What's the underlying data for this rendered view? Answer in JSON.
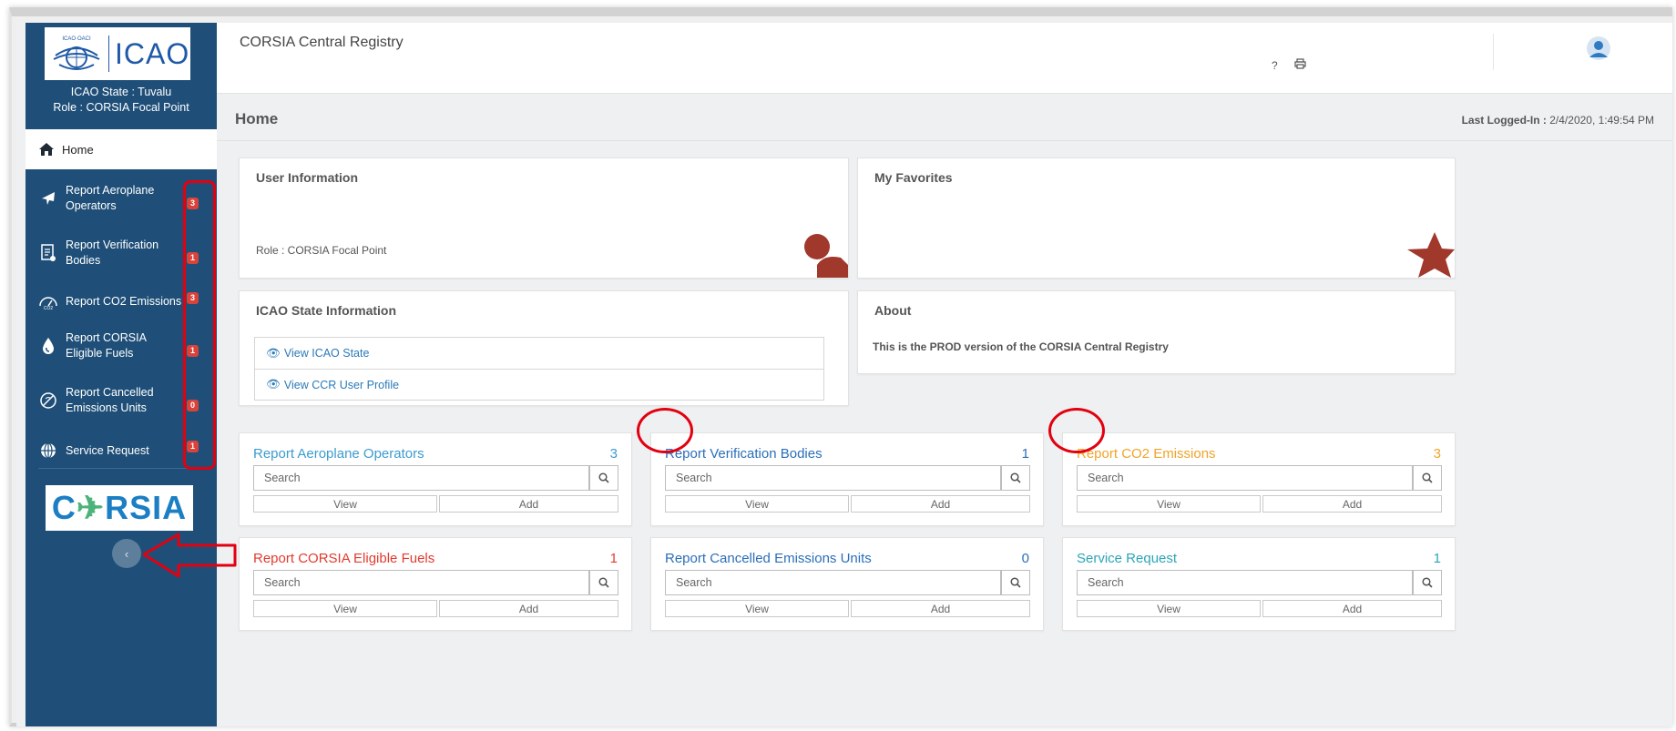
{
  "app": {
    "logo_text": "ICAO",
    "title": "CORSIA Central Registry",
    "state_line": "ICAO State : Tuvalu",
    "role_line": "Role : CORSIA Focal Point",
    "corsia_logo_text": "C",
    "corsia_logo_tail": "RSIA"
  },
  "topbar": {
    "help_icon": "?",
    "print_icon": "print-icon"
  },
  "sidebar": {
    "home_label": "Home",
    "items": [
      {
        "label": "Report Aeroplane Operators",
        "badge": "3",
        "icon": "airplane-icon"
      },
      {
        "label": "Report Verification Bodies",
        "badge": "1",
        "icon": "document-icon"
      },
      {
        "label": "Report CO2 Emissions",
        "badge": "3",
        "icon": "co2-gauge-icon"
      },
      {
        "label": "Report CORSIA Eligible Fuels",
        "badge": "1",
        "icon": "fuel-drop-icon"
      },
      {
        "label": "Report Cancelled Emissions Units",
        "badge": "0",
        "icon": "cancelled-icon"
      },
      {
        "label": "Service Request",
        "badge": "1",
        "icon": "globe-icon"
      }
    ],
    "collapse_icon": "‹"
  },
  "header": {
    "title": "Home",
    "last_login_label": "Last Logged-In :",
    "last_login_value": "2/4/2020, 1:49:54 PM"
  },
  "user_info": {
    "title": "User Information",
    "role": "Role : CORSIA Focal Point"
  },
  "favorites": {
    "title": "My Favorites"
  },
  "state_info": {
    "title": "ICAO State Information",
    "links": [
      "View ICAO State",
      "View CCR User Profile"
    ]
  },
  "about": {
    "title": "About",
    "text": "This is the  PROD  version of the CORSIA Central Registry"
  },
  "tiles": [
    {
      "title": "Report Aeroplane Operators",
      "count": "3",
      "color": "#3b9ccf",
      "placeholder": "Search",
      "view": "View",
      "add": "Add"
    },
    {
      "title": "Report Verification Bodies",
      "count": "1",
      "color": "#2a6fb8",
      "placeholder": "Search",
      "view": "View",
      "add": "Add"
    },
    {
      "title": "Report CO2 Emissions",
      "count": "3",
      "color": "#f0a429",
      "placeholder": "Search",
      "view": "View",
      "add": "Add"
    },
    {
      "title": "Report CORSIA Eligible Fuels",
      "count": "1",
      "color": "#e23b2e",
      "placeholder": "Search",
      "view": "View",
      "add": "Add"
    },
    {
      "title": "Report Cancelled Emissions Units",
      "count": "0",
      "color": "#2a6fb8",
      "placeholder": "Search",
      "view": "View",
      "add": "Add"
    },
    {
      "title": "Service Request",
      "count": "1",
      "color": "#2ba6b8",
      "placeholder": "Search",
      "view": "View",
      "add": "Add"
    }
  ],
  "colors": {
    "sidebar": "#1f4f78",
    "annotation": "#e3000f",
    "badge": "#d9433a"
  }
}
